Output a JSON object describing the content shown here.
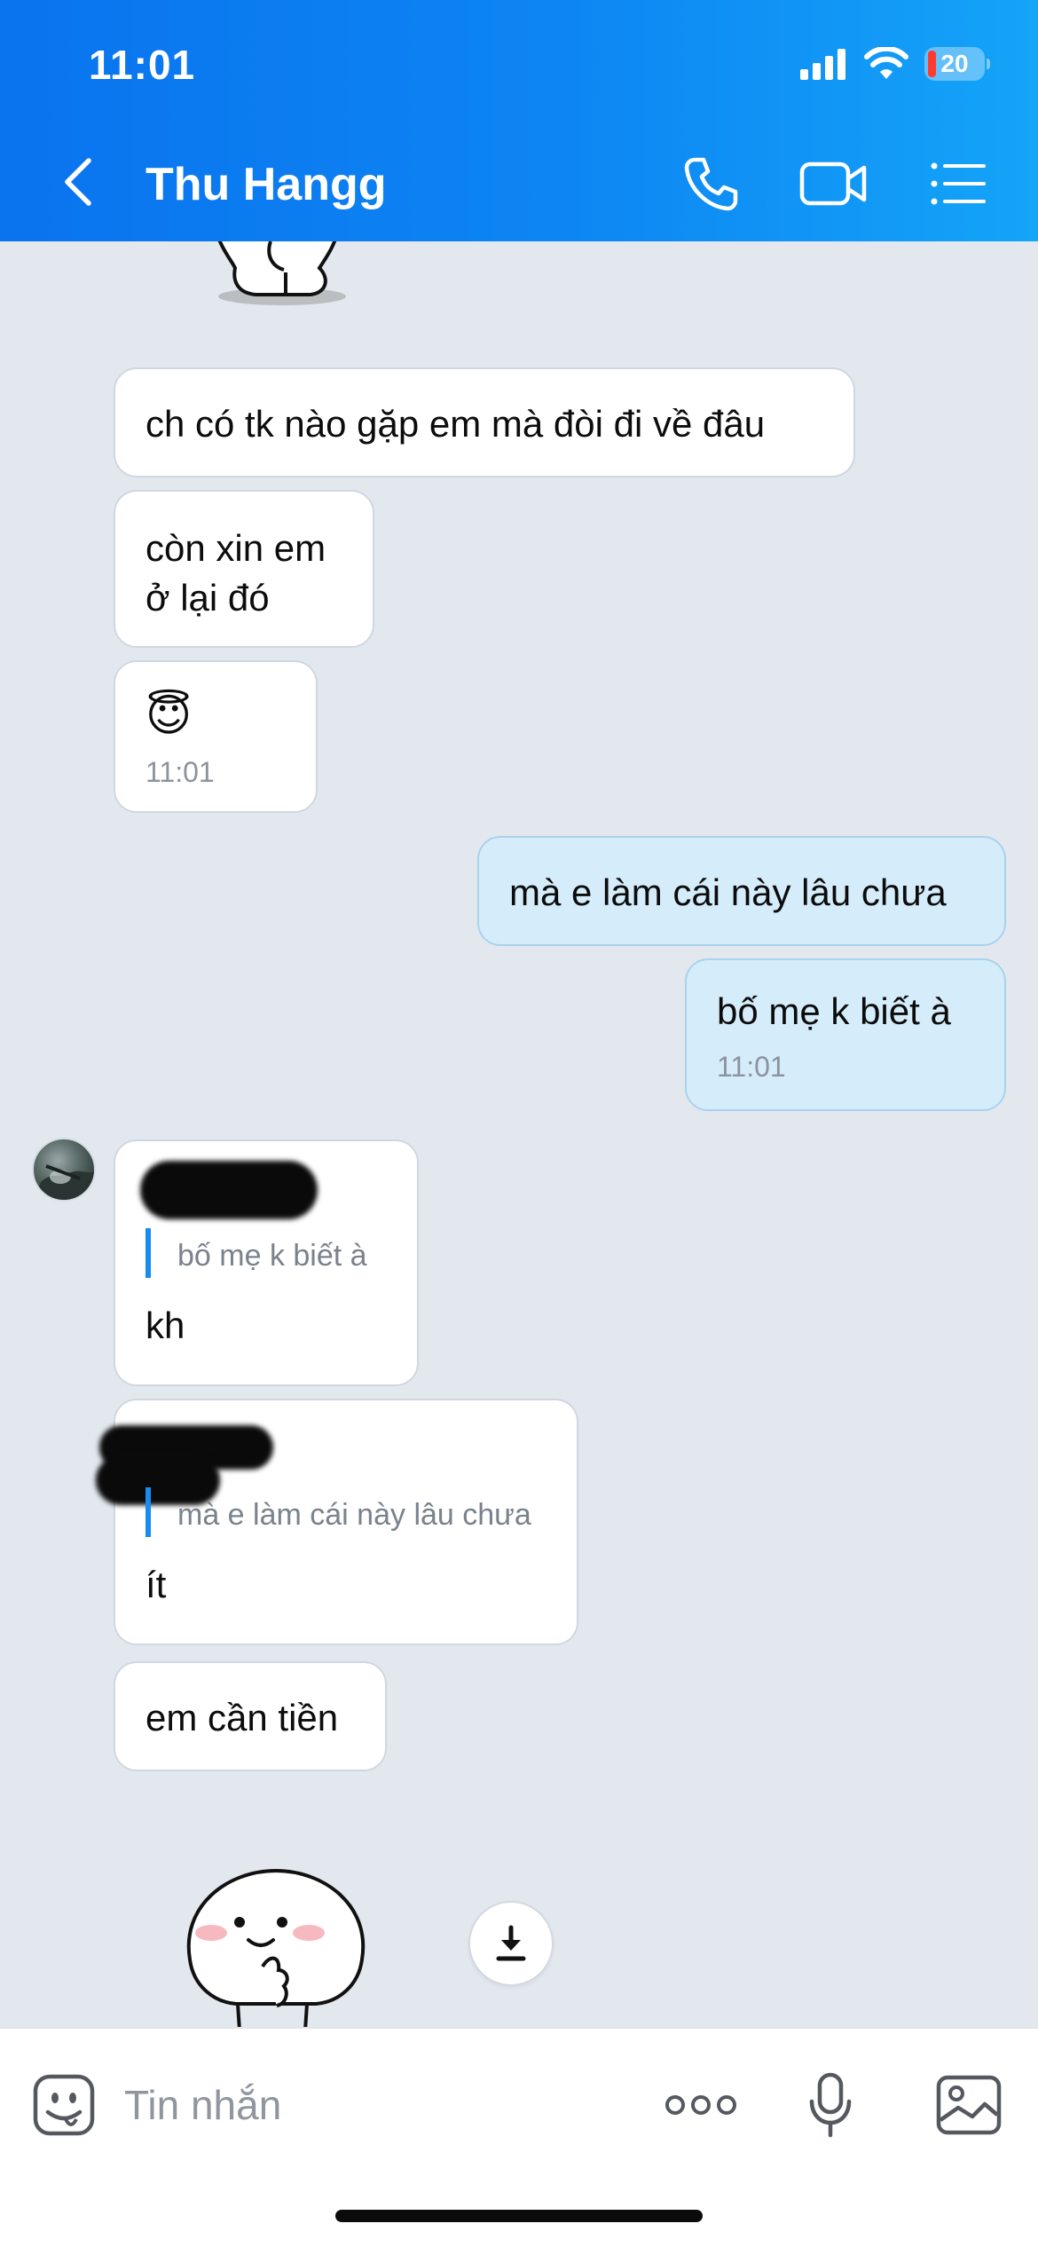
{
  "status_bar": {
    "time": "11:01",
    "battery_level": "20"
  },
  "header": {
    "contact_name": "Thu Hangg"
  },
  "messages": {
    "m1": {
      "text": "ch có tk nào gặp em mà đòi đi về đâu"
    },
    "m2": {
      "line1": "còn xin em",
      "line2": "ở lại đó"
    },
    "m3": {
      "emoji": "😇",
      "time": "11:01"
    },
    "m4": {
      "text": "mà e làm cái này lâu chưa"
    },
    "m5": {
      "text": "bố mẹ k biết à",
      "time": "11:01"
    },
    "m6": {
      "quote": "bố mẹ k biết à",
      "text": "kh"
    },
    "m7": {
      "quote": "mà e làm cái này lâu chưa",
      "text": "ít"
    },
    "m8": {
      "text": "em cần tiền"
    }
  },
  "composer": {
    "placeholder": "Tin nhắn"
  },
  "colors": {
    "header_start": "#0a73ee",
    "header_end": "#14a4f8",
    "outgoing_bubble": "#d5edfb",
    "incoming_bubble": "#ffffff",
    "chat_background": "#e3e8ef",
    "reply_bar": "#1a8cf0"
  }
}
